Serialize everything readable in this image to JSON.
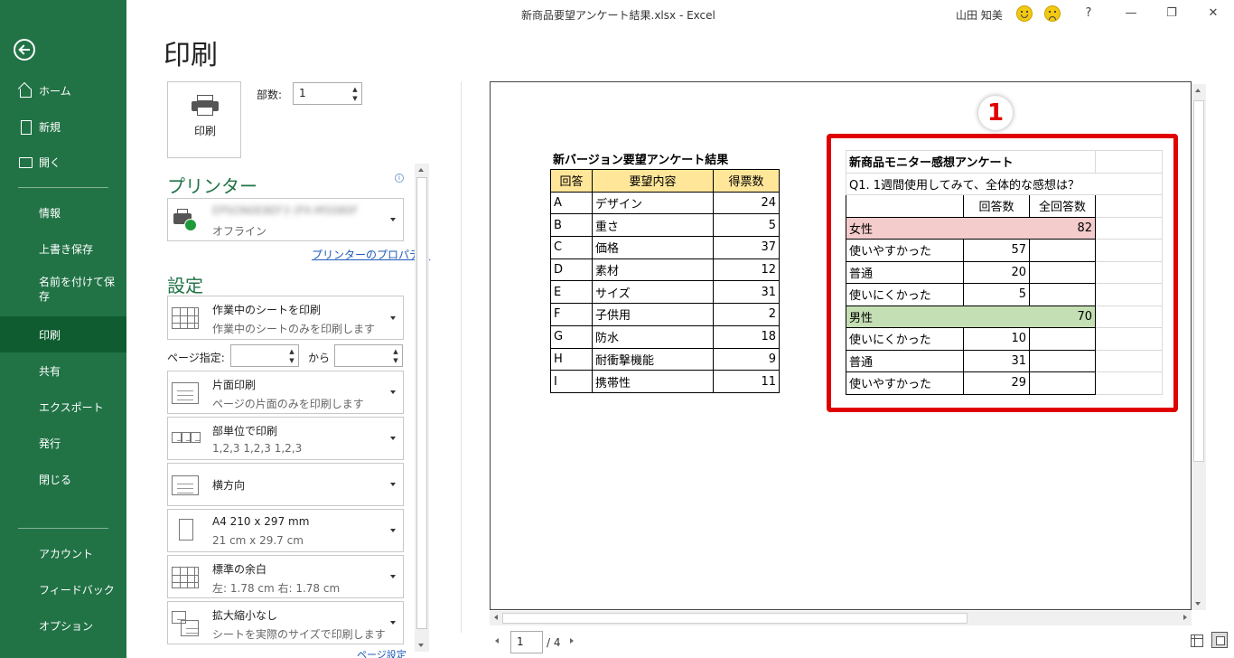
{
  "window": {
    "title": "新商品要望アンケート結果.xlsx  -  Excel",
    "user": "山田 知美",
    "help": "?",
    "minimize": "—",
    "restore": "❐",
    "close": "✕"
  },
  "nav": {
    "items": [
      {
        "label": "ホーム",
        "icon": "home-icon"
      },
      {
        "label": "新規",
        "icon": "new-document-icon"
      },
      {
        "label": "開く",
        "icon": "open-folder-icon"
      },
      {
        "label": "情報"
      },
      {
        "label": "上書き保存"
      },
      {
        "label": "名前を付けて保存"
      },
      {
        "label": "印刷",
        "active": true
      },
      {
        "label": "共有"
      },
      {
        "label": "エクスポート"
      },
      {
        "label": "発行"
      },
      {
        "label": "閉じる"
      },
      {
        "label": "アカウント"
      },
      {
        "label": "フィードバック"
      },
      {
        "label": "オプション"
      }
    ]
  },
  "print": {
    "heading": "印刷",
    "print_button": "印刷",
    "copies_label": "部数:",
    "copies_value": "1",
    "printer_section": "プリンター",
    "printer_name": "EPSON0E8EF3 (PX-M5080F",
    "printer_status": "オフライン",
    "printer_properties": "プリンターのプロパティ",
    "settings_section": "設定",
    "settings": [
      {
        "line1": "作業中のシートを印刷",
        "line2": "作業中のシートのみを印刷します"
      },
      {
        "line1": "片面印刷",
        "line2": "ページの片面のみを印刷します"
      },
      {
        "line1": "部単位で印刷",
        "line2": "1,2,3    1,2,3    1,2,3"
      },
      {
        "line1": "横方向"
      },
      {
        "line1": "A4 210 x 297 mm",
        "line2": "21 cm x 29.7 cm"
      },
      {
        "line1": "標準の余白",
        "line2": "左:  1.78 cm    右:  1.78 cm"
      },
      {
        "line1": "拡大縮小なし",
        "line2": "シートを実際のサイズで印刷します"
      }
    ],
    "page_range_label": "ページ指定:",
    "page_range_to": "から",
    "page_setup_link": "ページ設定"
  },
  "preview": {
    "table1": {
      "title": "新バージョン要望アンケート結果",
      "headers": [
        "回答",
        "要望内容",
        "得票数"
      ],
      "rows": [
        [
          "A",
          "デザイン",
          "24"
        ],
        [
          "B",
          "重さ",
          "5"
        ],
        [
          "C",
          "価格",
          "37"
        ],
        [
          "D",
          "素材",
          "12"
        ],
        [
          "E",
          "サイズ",
          "31"
        ],
        [
          "F",
          "子供用",
          "2"
        ],
        [
          "G",
          "防水",
          "18"
        ],
        [
          "H",
          "耐衝撃機能",
          "9"
        ],
        [
          "I",
          "携帯性",
          "11"
        ]
      ]
    },
    "table2": {
      "title": "新商品モニター感想アンケート",
      "question": "Q1. 1週間使用してみて、全体的な感想は？",
      "col_headers": [
        "回答数",
        "全回答数"
      ],
      "female": {
        "label": "女性",
        "total": "82"
      },
      "female_rows": [
        [
          "使いやすかった",
          "57"
        ],
        [
          "普通",
          "20"
        ],
        [
          "使いにくかった",
          "5"
        ]
      ],
      "male": {
        "label": "男性",
        "total": "70"
      },
      "male_rows": [
        [
          "使いにくかった",
          "10"
        ],
        [
          "普通",
          "31"
        ],
        [
          "使いやすかった",
          "29"
        ]
      ]
    },
    "callout": "1",
    "highlight_color": "#e00000",
    "page_current": "1",
    "page_total": "/ 4"
  },
  "colors": {
    "nav_bg": "#217346",
    "nav_active": "#0e5c2f",
    "table1_header": "#ffe699",
    "female_fill": "#f4cccc",
    "male_fill": "#c5dfb4"
  }
}
